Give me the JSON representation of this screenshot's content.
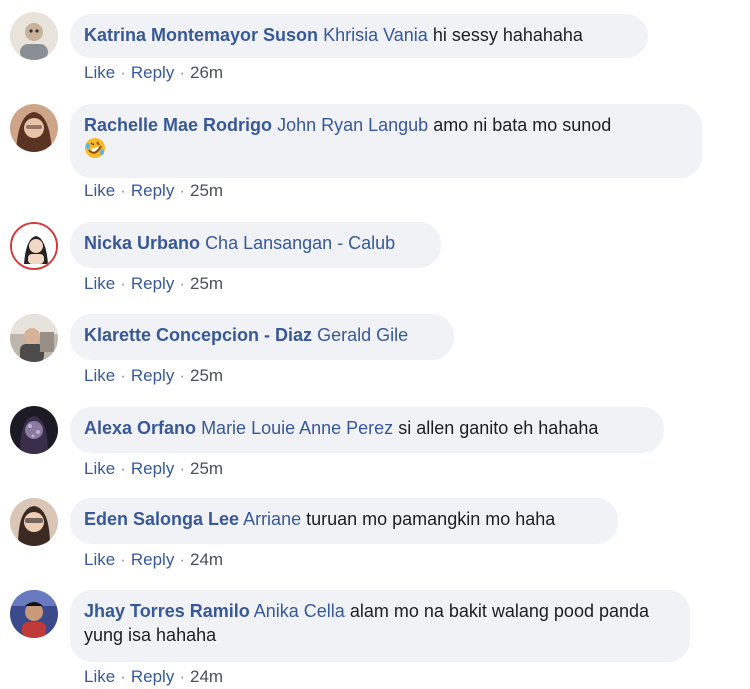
{
  "comments": [
    {
      "author": "Katrina Montemayor Suson",
      "mention": "Khrisia Vania",
      "text": "hi sessy hahahaha",
      "like": "Like",
      "reply": "Reply",
      "time": "26m"
    },
    {
      "author": "Rachelle Mae Rodrigo",
      "mention": "John Ryan Langub",
      "text": "amo ni bata mo sunod",
      "emoji": "rolling-laughing-emoji",
      "like": "Like",
      "reply": "Reply",
      "time": "25m"
    },
    {
      "author": "Nicka Urbano",
      "mention": "Cha Lansangan - Calub",
      "text": "",
      "like": "Like",
      "reply": "Reply",
      "time": "25m"
    },
    {
      "author": "Klarette Concepcion - Diaz",
      "mention": "Gerald Gile",
      "text": "",
      "like": "Like",
      "reply": "Reply",
      "time": "25m"
    },
    {
      "author": "Alexa Orfano",
      "mention": "Marie Louie Anne Perez",
      "text": "si allen ganito eh hahaha",
      "like": "Like",
      "reply": "Reply",
      "time": "25m"
    },
    {
      "author": "Eden Salonga Lee",
      "mention": "Arriane",
      "text": "turuan mo pamangkin mo haha",
      "like": "Like",
      "reply": "Reply",
      "time": "24m"
    },
    {
      "author": "Jhay Torres Ramilo",
      "mention": "Anika Cella",
      "text": "alam mo na bakit walang pood panda yung isa hahaha",
      "like": "Like",
      "reply": "Reply",
      "time": "24m"
    }
  ],
  "colors": {
    "link": "#385898",
    "bubble": "#f0f2f5",
    "text": "#1c1e21",
    "meta": "#4b4f56"
  }
}
